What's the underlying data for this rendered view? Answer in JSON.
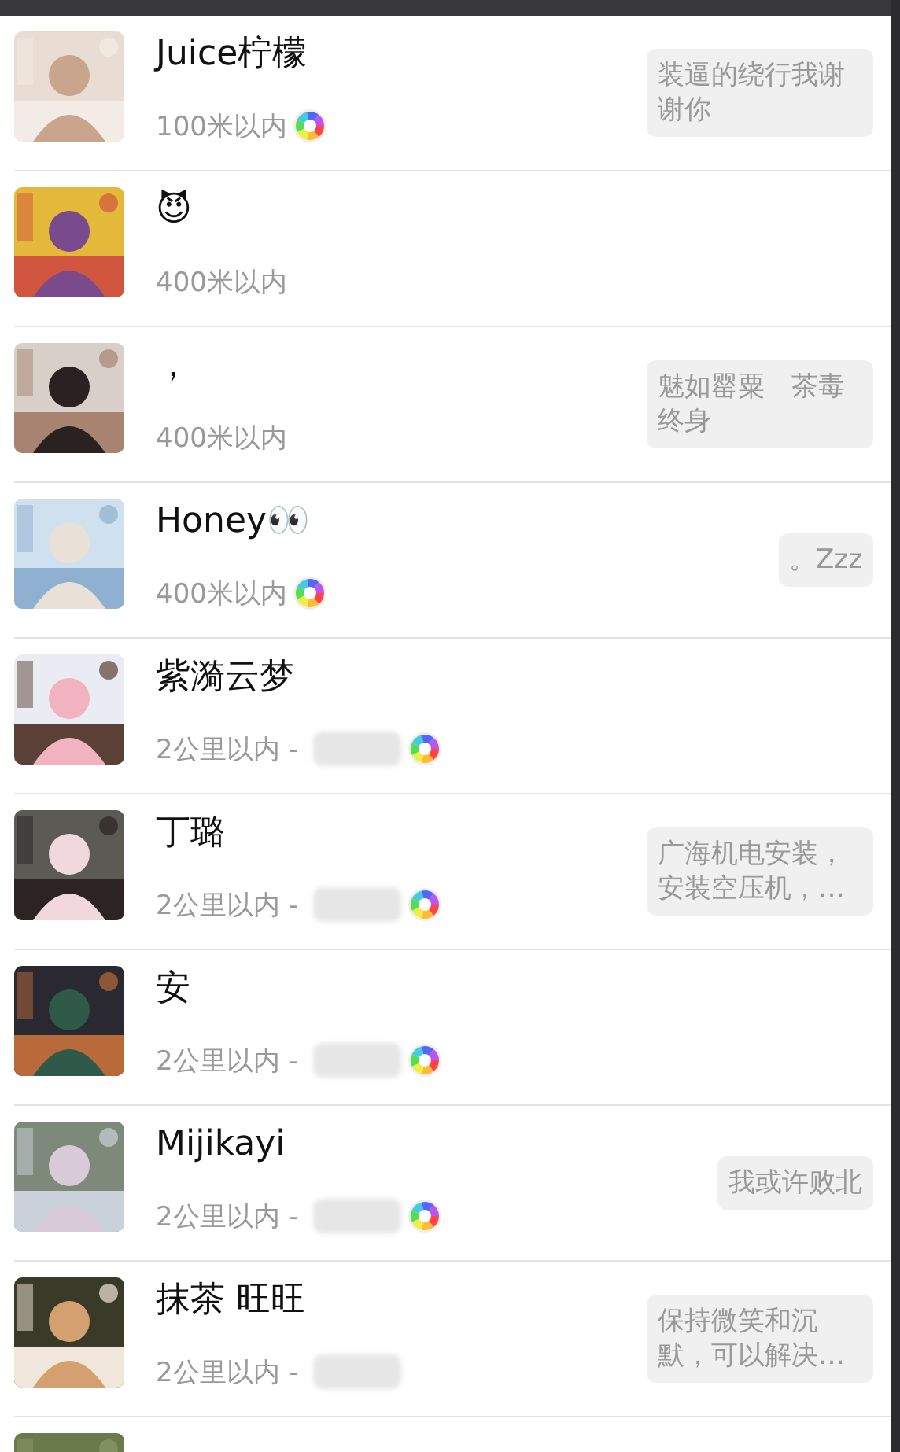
{
  "people": [
    {
      "name": "Juice柠檬",
      "distance": "100米以内",
      "location_redacted": false,
      "moments": true,
      "signature": "装逼的绕行我谢谢你"
    },
    {
      "name": "😈",
      "distance": "400米以内",
      "location_redacted": false,
      "moments": false
    },
    {
      "name": "，",
      "distance": "400米以内",
      "location_redacted": false,
      "moments": false,
      "signature": "魅如罂粟　茶毒终身"
    },
    {
      "name": "Honey👀",
      "distance": "400米以内",
      "location_redacted": false,
      "moments": true,
      "signature": "。Zzz"
    },
    {
      "name": "紫漪云梦",
      "distance": "2公里以内 -",
      "location_redacted": true,
      "moments": true
    },
    {
      "name": "丁璐",
      "distance": "2公里以内 -",
      "location_redacted": true,
      "moments": true,
      "signature": "广海机电安装，安装空压机，…"
    },
    {
      "name": "安",
      "distance": "2公里以内 -",
      "location_redacted": true,
      "moments": true
    },
    {
      "name": "Mijikayi",
      "distance": "2公里以内 -",
      "location_redacted": true,
      "moments": true,
      "signature": "我或许败北"
    },
    {
      "name": "抹茶 旺旺",
      "distance": "2公里以内 -",
      "location_redacted": true,
      "moments": false,
      "signature": "保持微笑和沉默，可以解决…"
    }
  ]
}
